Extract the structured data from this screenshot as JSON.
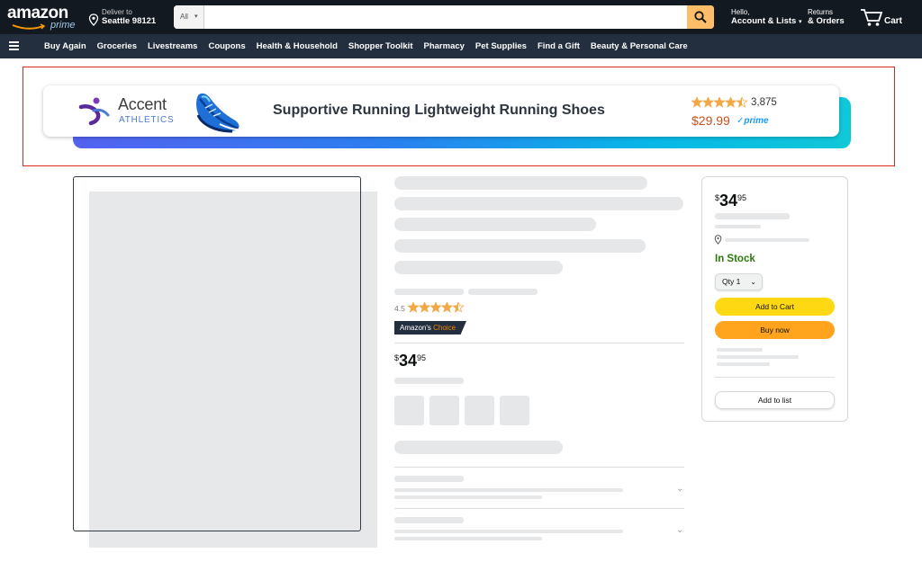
{
  "header": {
    "logo_text": "amazon",
    "logo_sub": "prime",
    "deliver_line1": "Deliver to",
    "deliver_line2": "Seattle 98121",
    "search_category": "All",
    "search_placeholder": "",
    "account_line1": "Hello,",
    "account_line2": "Account & Lists",
    "returns_line1": "Returns",
    "returns_line2": "& Orders",
    "cart_label": "Cart"
  },
  "nav": {
    "links": [
      "Buy Again",
      "Groceries",
      "Livestreams",
      "Coupons",
      "Health & Household",
      "Shopper Toolkit",
      "Pharmacy",
      "Pet Supplies",
      "Find a Gift",
      "Beauty & Personal Care"
    ]
  },
  "banner": {
    "brand_name": "Accent",
    "brand_sub": "ATHLETICS",
    "title": "Supportive Running Lightweight Running Shoes",
    "rating": 4.5,
    "review_count": "3,875",
    "price": "$29.99",
    "prime_label": "✓prime",
    "colors": {
      "star": "#f3a847",
      "price": "#c7511f",
      "prime": "#1a98ff"
    }
  },
  "product": {
    "rating_value": "4.5",
    "badge_prefix": "Amazon's",
    "badge_suffix": "Choice",
    "price_currency": "$",
    "price_whole": "34",
    "price_fraction": "95"
  },
  "buybox": {
    "price_currency": "$",
    "price_whole": "34",
    "price_fraction": "95",
    "stock_status": "In Stock",
    "qty_label": "Qty 1",
    "add_to_cart": "Add to Cart",
    "buy_now": "Buy now",
    "add_to_list": "Add to list",
    "colors": {
      "stock": "#2b7a0b",
      "cart_button": "#ffd814",
      "buy_button": "#ffa41c"
    }
  }
}
